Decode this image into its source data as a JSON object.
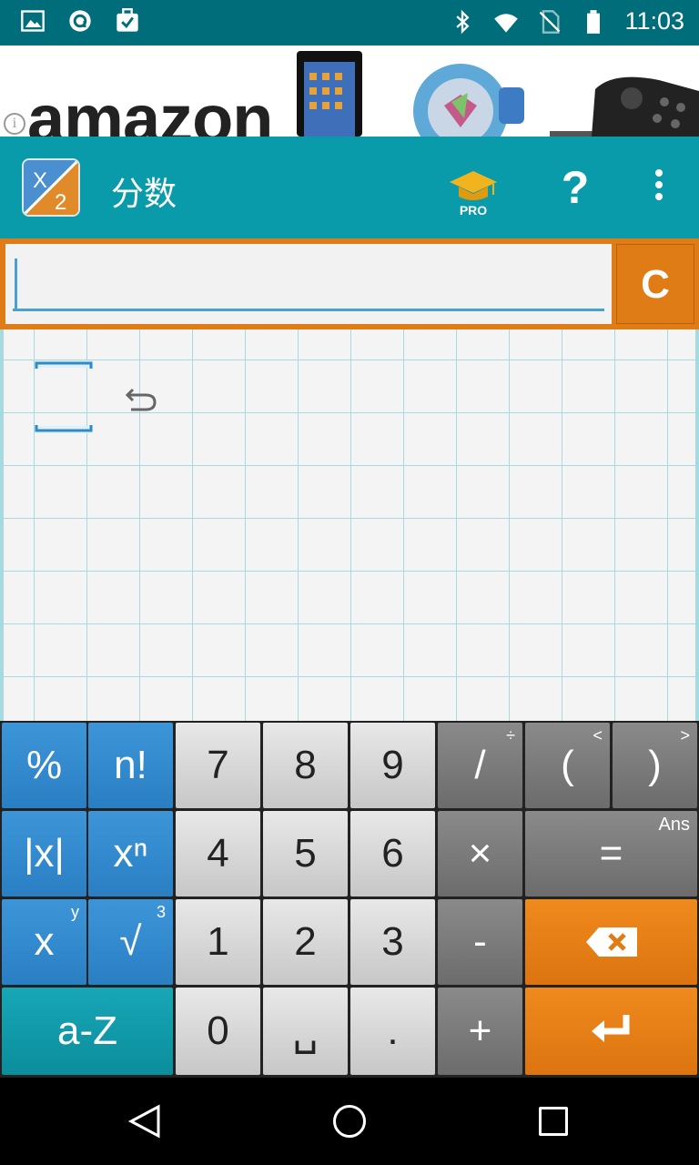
{
  "status_bar": {
    "time": "11:03",
    "icons_left": [
      "image-icon",
      "assistant-icon",
      "clipboard-check-icon"
    ],
    "icons_right": [
      "bluetooth-icon",
      "wifi-icon",
      "no-sim-icon",
      "battery-icon"
    ]
  },
  "ad": {
    "brand_text": "amazon",
    "info_symbol": "i"
  },
  "app_bar": {
    "icon_top": "X",
    "icon_bottom": "2",
    "title": "分数",
    "pro_label": "PRO",
    "help_label": "?"
  },
  "input": {
    "value": "",
    "clear_label": "C"
  },
  "keypad": {
    "percent": "%",
    "factorial": "n!",
    "seven": "7",
    "eight": "8",
    "nine": "9",
    "divide": "/",
    "divide_alt": "÷",
    "paren_open": "(",
    "paren_open_alt": "<",
    "paren_close": ")",
    "paren_close_alt": ">",
    "abs": "|x|",
    "power": "xⁿ",
    "four": "4",
    "five": "5",
    "six": "6",
    "multiply": "×",
    "equals": "=",
    "equals_alt": "Ans",
    "sub_x": "x",
    "sub_x_alt": "y",
    "sqrt": "√",
    "sqrt_alt": "3",
    "one": "1",
    "two": "2",
    "three": "3",
    "minus": "-",
    "alpha": "a-Z",
    "zero": "0",
    "space": "␣",
    "dot": ".",
    "plus": "+"
  },
  "colors": {
    "status_bar": "#006d7a",
    "app_bar": "#0a9bab",
    "accent_orange": "#e07c16",
    "grid_line": "#a6d9e0",
    "key_blue": "#2a7fc3"
  }
}
